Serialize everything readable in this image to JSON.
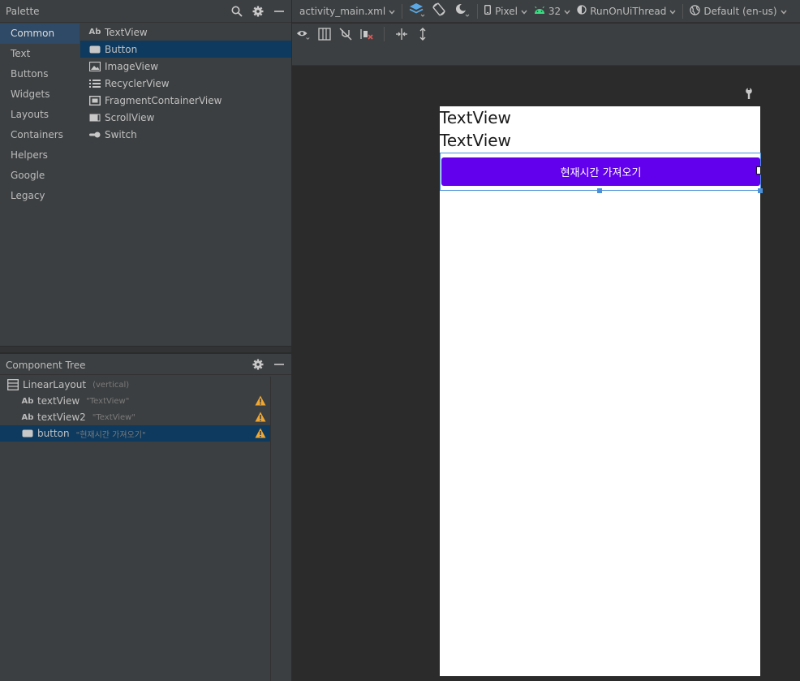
{
  "palette": {
    "title": "Palette",
    "categories": [
      "Common",
      "Text",
      "Buttons",
      "Widgets",
      "Layouts",
      "Containers",
      "Helpers",
      "Google",
      "Legacy"
    ],
    "selected_category": "Common",
    "items": [
      {
        "label": "TextView",
        "icon": "ab-text-icon",
        "icon_text": "Ab"
      },
      {
        "label": "Button",
        "icon": "button-icon"
      },
      {
        "label": "ImageView",
        "icon": "image-icon"
      },
      {
        "label": "RecyclerView",
        "icon": "list-icon"
      },
      {
        "label": "FragmentContainerView",
        "icon": "fragment-icon"
      },
      {
        "label": "ScrollView",
        "icon": "scroll-icon"
      },
      {
        "label": "Switch",
        "icon": "switch-icon"
      }
    ],
    "selected_item": "Button"
  },
  "component_tree": {
    "title": "Component Tree",
    "rows": [
      {
        "name": "LinearLayout",
        "hint": "(vertical)",
        "icon": "linear-layout-icon"
      },
      {
        "name": "textView",
        "hint": "\"TextView\"",
        "icon": "ab-text-icon",
        "icon_text": "Ab",
        "warning": true
      },
      {
        "name": "textView2",
        "hint": "\"TextView\"",
        "icon": "ab-text-icon",
        "icon_text": "Ab",
        "warning": true
      },
      {
        "name": "button",
        "hint": "\"현재시간 가져오기\"",
        "icon": "button-icon",
        "warning": true
      }
    ],
    "selected_row": "button"
  },
  "toolbar": {
    "file": "activity_main.xml",
    "device": "Pixel",
    "api": "32",
    "theme": "RunOnUiThread",
    "locale": "Default (en-us)"
  },
  "preview": {
    "textview1": "TextView",
    "textview2": "TextView",
    "button_label": "현재시간 가져오기",
    "button_color": "#6200ee"
  },
  "colors": {
    "panel_bg": "#3c3f41",
    "editor_bg": "#2b2b2b",
    "selection": "#0d3a5e",
    "warning": "#f0a732",
    "accent": "#4a90d9"
  }
}
